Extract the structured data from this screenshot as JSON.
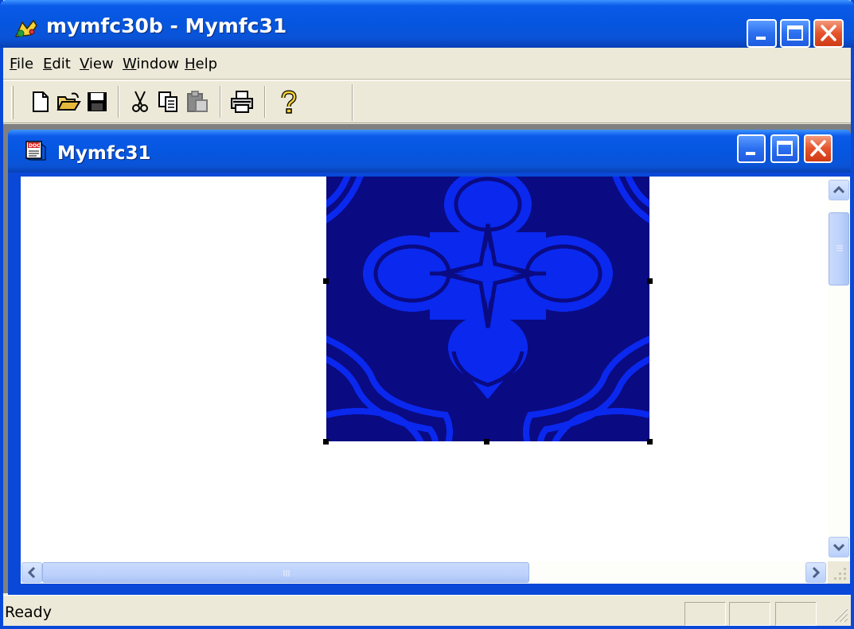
{
  "window": {
    "title": "mymfc30b - Mymfc31"
  },
  "menu": {
    "items": [
      {
        "label": "File",
        "accel": "F"
      },
      {
        "label": "Edit",
        "accel": "E"
      },
      {
        "label": "View",
        "accel": "V"
      },
      {
        "label": "Window",
        "accel": "W"
      },
      {
        "label": "Help",
        "accel": "H"
      }
    ]
  },
  "toolbar": {
    "buttons": [
      {
        "name": "new-icon"
      },
      {
        "name": "open-icon"
      },
      {
        "name": "save-icon"
      },
      {
        "name": "cut-icon"
      },
      {
        "name": "copy-icon"
      },
      {
        "name": "paste-icon"
      },
      {
        "name": "print-icon"
      },
      {
        "name": "help-icon"
      }
    ]
  },
  "document": {
    "title": "Mymfc31"
  },
  "canvas": {
    "tile_colors": {
      "dark": "#0a0a82",
      "light": "#0a28ee"
    }
  },
  "status": {
    "text": "Ready"
  },
  "colors": {
    "title_bar": "#0556e0",
    "close_button": "#e5542c",
    "chrome": "#ece9d8"
  }
}
